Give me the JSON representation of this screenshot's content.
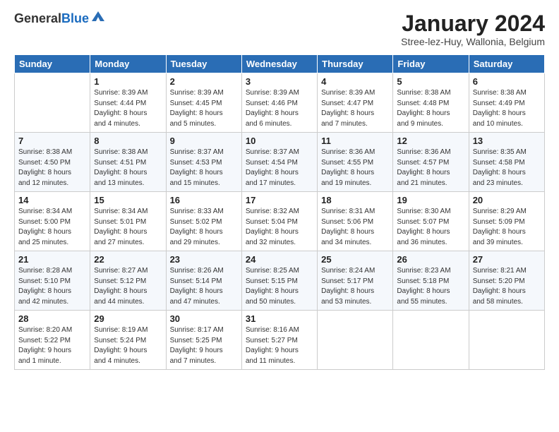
{
  "header": {
    "logo": {
      "general": "General",
      "blue": "Blue"
    },
    "title": "January 2024",
    "location": "Stree-lez-Huy, Wallonia, Belgium"
  },
  "days_of_week": [
    "Sunday",
    "Monday",
    "Tuesday",
    "Wednesday",
    "Thursday",
    "Friday",
    "Saturday"
  ],
  "weeks": [
    [
      {
        "day": "",
        "info": ""
      },
      {
        "day": "1",
        "info": "Sunrise: 8:39 AM\nSunset: 4:44 PM\nDaylight: 8 hours\nand 4 minutes."
      },
      {
        "day": "2",
        "info": "Sunrise: 8:39 AM\nSunset: 4:45 PM\nDaylight: 8 hours\nand 5 minutes."
      },
      {
        "day": "3",
        "info": "Sunrise: 8:39 AM\nSunset: 4:46 PM\nDaylight: 8 hours\nand 6 minutes."
      },
      {
        "day": "4",
        "info": "Sunrise: 8:39 AM\nSunset: 4:47 PM\nDaylight: 8 hours\nand 7 minutes."
      },
      {
        "day": "5",
        "info": "Sunrise: 8:38 AM\nSunset: 4:48 PM\nDaylight: 8 hours\nand 9 minutes."
      },
      {
        "day": "6",
        "info": "Sunrise: 8:38 AM\nSunset: 4:49 PM\nDaylight: 8 hours\nand 10 minutes."
      }
    ],
    [
      {
        "day": "7",
        "info": ""
      },
      {
        "day": "8",
        "info": "Sunrise: 8:38 AM\nSunset: 4:51 PM\nDaylight: 8 hours\nand 13 minutes."
      },
      {
        "day": "9",
        "info": "Sunrise: 8:37 AM\nSunset: 4:53 PM\nDaylight: 8 hours\nand 15 minutes."
      },
      {
        "day": "10",
        "info": "Sunrise: 8:37 AM\nSunset: 4:54 PM\nDaylight: 8 hours\nand 17 minutes."
      },
      {
        "day": "11",
        "info": "Sunrise: 8:36 AM\nSunset: 4:55 PM\nDaylight: 8 hours\nand 19 minutes."
      },
      {
        "day": "12",
        "info": "Sunrise: 8:36 AM\nSunset: 4:57 PM\nDaylight: 8 hours\nand 21 minutes."
      },
      {
        "day": "13",
        "info": "Sunrise: 8:35 AM\nSunset: 4:58 PM\nDaylight: 8 hours\nand 23 minutes."
      }
    ],
    [
      {
        "day": "14",
        "info": ""
      },
      {
        "day": "15",
        "info": "Sunrise: 8:34 AM\nSunset: 5:01 PM\nDaylight: 8 hours\nand 27 minutes."
      },
      {
        "day": "16",
        "info": "Sunrise: 8:33 AM\nSunset: 5:02 PM\nDaylight: 8 hours\nand 29 minutes."
      },
      {
        "day": "17",
        "info": "Sunrise: 8:32 AM\nSunset: 5:04 PM\nDaylight: 8 hours\nand 32 minutes."
      },
      {
        "day": "18",
        "info": "Sunrise: 8:31 AM\nSunset: 5:06 PM\nDaylight: 8 hours\nand 34 minutes."
      },
      {
        "day": "19",
        "info": "Sunrise: 8:30 AM\nSunset: 5:07 PM\nDaylight: 8 hours\nand 36 minutes."
      },
      {
        "day": "20",
        "info": "Sunrise: 8:29 AM\nSunset: 5:09 PM\nDaylight: 8 hours\nand 39 minutes."
      }
    ],
    [
      {
        "day": "21",
        "info": ""
      },
      {
        "day": "22",
        "info": "Sunrise: 8:27 AM\nSunset: 5:12 PM\nDaylight: 8 hours\nand 44 minutes."
      },
      {
        "day": "23",
        "info": "Sunrise: 8:26 AM\nSunset: 5:14 PM\nDaylight: 8 hours\nand 47 minutes."
      },
      {
        "day": "24",
        "info": "Sunrise: 8:25 AM\nSunset: 5:15 PM\nDaylight: 8 hours\nand 50 minutes."
      },
      {
        "day": "25",
        "info": "Sunrise: 8:24 AM\nSunset: 5:17 PM\nDaylight: 8 hours\nand 53 minutes."
      },
      {
        "day": "26",
        "info": "Sunrise: 8:23 AM\nSunset: 5:18 PM\nDaylight: 8 hours\nand 55 minutes."
      },
      {
        "day": "27",
        "info": "Sunrise: 8:21 AM\nSunset: 5:20 PM\nDaylight: 8 hours\nand 58 minutes."
      }
    ],
    [
      {
        "day": "28",
        "info": ""
      },
      {
        "day": "29",
        "info": "Sunrise: 8:19 AM\nSunset: 5:24 PM\nDaylight: 9 hours\nand 4 minutes."
      },
      {
        "day": "30",
        "info": "Sunrise: 8:17 AM\nSunset: 5:25 PM\nDaylight: 9 hours\nand 7 minutes."
      },
      {
        "day": "31",
        "info": "Sunrise: 8:16 AM\nSunset: 5:27 PM\nDaylight: 9 hours\nand 11 minutes."
      },
      {
        "day": "",
        "info": ""
      },
      {
        "day": "",
        "info": ""
      },
      {
        "day": "",
        "info": ""
      }
    ]
  ],
  "week_first_day_info": [
    "",
    "Sunrise: 8:38 AM\nSunset: 4:50 PM\nDaylight: 8 hours\nand 12 minutes.",
    "Sunrise: 8:34 AM\nSunset: 5:00 PM\nDaylight: 8 hours\nand 25 minutes.",
    "Sunrise: 8:28 AM\nSunset: 5:10 PM\nDaylight: 8 hours\nand 42 minutes.",
    "Sunrise: 8:20 AM\nSunset: 5:22 PM\nDaylight: 9 hours\nand 1 minute."
  ]
}
